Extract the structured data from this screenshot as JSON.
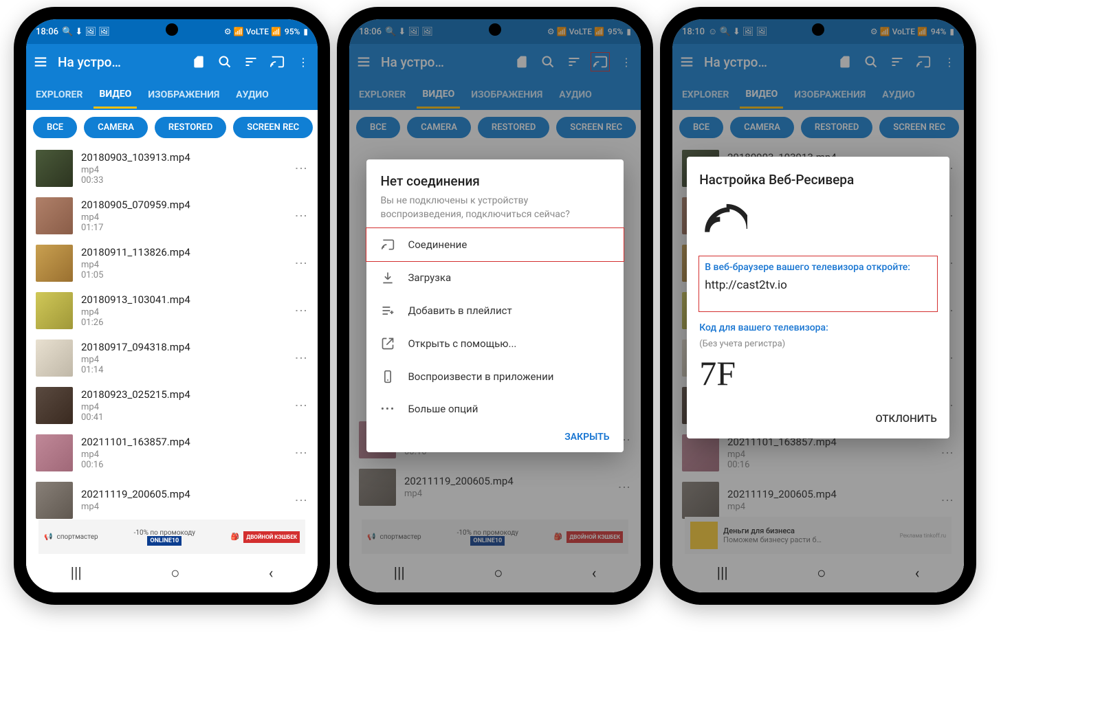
{
  "screens": [
    {
      "time": "18:06",
      "battery": "95%"
    },
    {
      "time": "18:06",
      "battery": "95%"
    },
    {
      "time": "18:10",
      "battery": "94%"
    }
  ],
  "toolbar": {
    "title": "На устро…"
  },
  "tabs": [
    "EXPLORER",
    "ВИДЕО",
    "ИЗОБРАЖЕНИЯ",
    "АУДИО"
  ],
  "activeTab": 1,
  "chips": [
    "ВСЕ",
    "CAMERA",
    "RESTORED",
    "SCREEN REC"
  ],
  "files": [
    {
      "name": "20180903_103913.mp4",
      "ext": "mp4",
      "dur": "00:33",
      "c": "c1"
    },
    {
      "name": "20180905_070959.mp4",
      "ext": "mp4",
      "dur": "01:17",
      "c": "c2"
    },
    {
      "name": "20180911_113826.mp4",
      "ext": "mp4",
      "dur": "01:05",
      "c": "c3"
    },
    {
      "name": "20180913_103041.mp4",
      "ext": "mp4",
      "dur": "01:26",
      "c": "c4"
    },
    {
      "name": "20180917_094318.mp4",
      "ext": "mp4",
      "dur": "01:14",
      "c": "c5"
    },
    {
      "name": "20180923_025215.mp4",
      "ext": "mp4",
      "dur": "00:41",
      "c": "c6"
    },
    {
      "name": "20211101_163857.mp4",
      "ext": "mp4",
      "dur": "00:16",
      "c": "c7"
    },
    {
      "name": "20211119_200605.mp4",
      "ext": "mp4",
      "dur": "",
      "c": "c8"
    }
  ],
  "files_s2_top": {
    "name": "20211119_200605.mp4",
    "ext": "mp4"
  },
  "files_s2": [
    {
      "name": "20211101_163857.mp4",
      "ext": "mp4",
      "dur": "00:16",
      "c": "c7"
    },
    {
      "name": "20211119_200605.mp4",
      "ext": "mp4",
      "dur": "",
      "c": "c8"
    }
  ],
  "dialog": {
    "title": "Нет соединения",
    "subtitle": "Вы не подключены к устройству воспроизведения, подключиться сейчас?",
    "options": [
      {
        "label": "Соединение",
        "icon": "cast",
        "highlight": true
      },
      {
        "label": "Загрузка",
        "icon": "download"
      },
      {
        "label": "Добавить в плейлист",
        "icon": "playlist"
      },
      {
        "label": "Открыть с помощью...",
        "icon": "open"
      },
      {
        "label": "Воспроизвести в приложении",
        "icon": "phone"
      },
      {
        "label": "Больше опций",
        "icon": "more"
      }
    ],
    "close": "ЗАКРЫТЬ"
  },
  "receiver": {
    "title": "Настройка Веб-Ресивера",
    "browser_label": "В веб-браузере вашего телевизора откройте:",
    "url": "http://cast2tv.io",
    "code_label": "Код для вашего телевизора:",
    "code_note": "(Без учета регистра)",
    "code": "7F",
    "decline": "ОТКЛОНИТЬ"
  },
  "ad": {
    "promo_text": "-10% по промокоду",
    "brand": "спортмастер",
    "code": "ONLINE10",
    "right": "ДВОЙНОЙ КЭШБЕК"
  },
  "ad3": {
    "title": "Деньги для бизнеса",
    "sub": "Поможем бизнесу расти б…",
    "tag": "Реклама tinkoff.ru"
  }
}
